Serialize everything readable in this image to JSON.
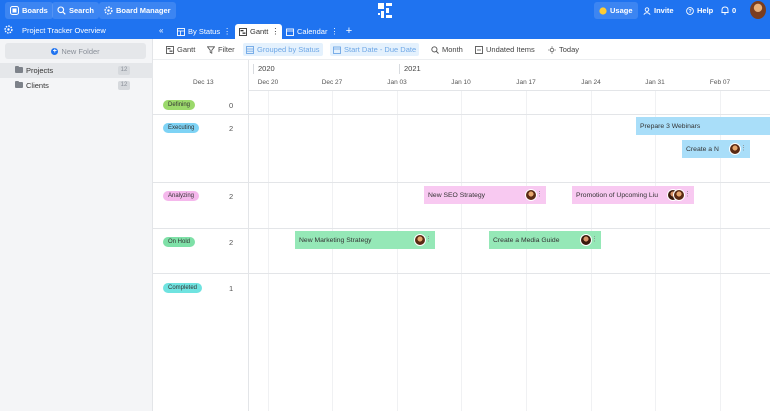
{
  "topbar": {
    "boards": "Boards",
    "search": "Search",
    "board_manager": "Board Manager",
    "usage": "Usage",
    "invite": "Invite",
    "help": "Help",
    "notifications_count": "0",
    "accent_color": "#1f73f0"
  },
  "sidebar": {
    "title": "Project Tracker Overview",
    "new_folder": "New Folder",
    "folders": [
      {
        "name": "Projects",
        "count": "12"
      },
      {
        "name": "Clients",
        "count": "12"
      }
    ]
  },
  "tabs": [
    {
      "label": "By Status",
      "icon": "table-icon"
    },
    {
      "label": "Gantt",
      "icon": "gantt-icon"
    },
    {
      "label": "Calendar",
      "icon": "calendar-icon"
    }
  ],
  "toolbar": {
    "gantt": "Gantt",
    "filter": "Filter",
    "grouped": "Grouped by Status",
    "dates": "Start Date - Due Date",
    "month": "Month",
    "undated": "Undated Items",
    "today": "Today"
  },
  "timeline": {
    "years": [
      "2020",
      "2021"
    ],
    "dates": [
      "Dec 13",
      "Dec 20",
      "Dec 27",
      "Jan 03",
      "Jan 10",
      "Jan 17",
      "Jan 24",
      "Jan 31",
      "Feb 07"
    ]
  },
  "groups": [
    {
      "status": "Defining",
      "count": "0",
      "color": "#9bd96b"
    },
    {
      "status": "Executing",
      "count": "2",
      "color": "#7ed3f5"
    },
    {
      "status": "Analyzing",
      "count": "2",
      "color": "#f5b8ec"
    },
    {
      "status": "On Hold",
      "count": "2",
      "color": "#7ee0a7"
    },
    {
      "status": "Completed",
      "count": "1",
      "color": "#6fe3e0"
    }
  ],
  "tasks": {
    "webinars": "Prepare 3 Webinars",
    "create_n": "Create a N",
    "seo": "New SEO Strategy",
    "promotion": "Promotion of Upcoming Liu",
    "marketing": "New Marketing Strategy",
    "media_guide": "Create a Media Guide"
  }
}
